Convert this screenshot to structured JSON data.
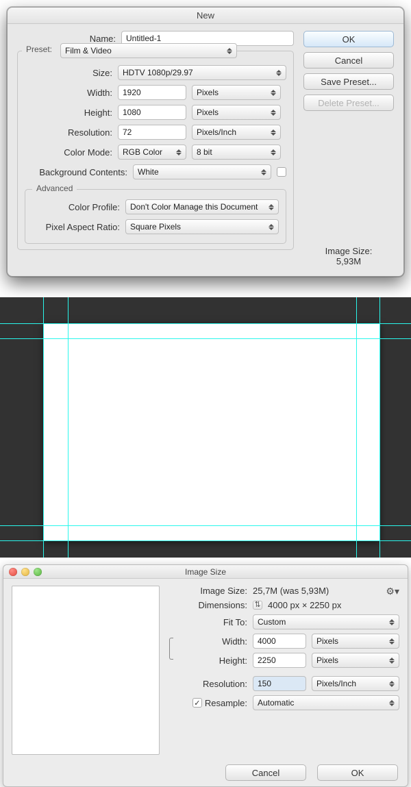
{
  "new_dialog": {
    "title": "New",
    "labels": {
      "name": "Name:",
      "preset": "Preset:",
      "size": "Size:",
      "width": "Width:",
      "height": "Height:",
      "resolution": "Resolution:",
      "color_mode": "Color Mode:",
      "bg_contents": "Background Contents:",
      "advanced": "Advanced",
      "color_profile": "Color Profile:",
      "pixel_aspect": "Pixel Aspect Ratio:",
      "image_size_label": "Image Size:"
    },
    "values": {
      "name": "Untitled-1",
      "preset": "Film & Video",
      "size": "HDTV 1080p/29.97",
      "width": "1920",
      "width_unit": "Pixels",
      "height": "1080",
      "height_unit": "Pixels",
      "resolution": "72",
      "resolution_unit": "Pixels/Inch",
      "color_mode": "RGB Color",
      "color_depth": "8 bit",
      "bg_contents": "White",
      "color_profile": "Don't Color Manage this Document",
      "pixel_aspect": "Square Pixels",
      "image_size": "5,93M"
    },
    "buttons": {
      "ok": "OK",
      "cancel": "Cancel",
      "save_preset": "Save Preset...",
      "delete_preset": "Delete Preset..."
    }
  },
  "image_size_dialog": {
    "title": "Image Size",
    "labels": {
      "image_size": "Image Size:",
      "dimensions": "Dimensions:",
      "fit_to": "Fit To:",
      "width": "Width:",
      "height": "Height:",
      "resolution": "Resolution:",
      "resample": "Resample:"
    },
    "values": {
      "image_size": "25,7M (was 5,93M)",
      "dimensions": "4000 px  ×  2250 px",
      "fit_to": "Custom",
      "width": "4000",
      "width_unit": "Pixels",
      "height": "2250",
      "height_unit": "Pixels",
      "resolution": "150",
      "resolution_unit": "Pixels/Inch",
      "resample_checked": true,
      "resample": "Automatic"
    },
    "buttons": {
      "cancel": "Cancel",
      "ok": "OK"
    }
  }
}
